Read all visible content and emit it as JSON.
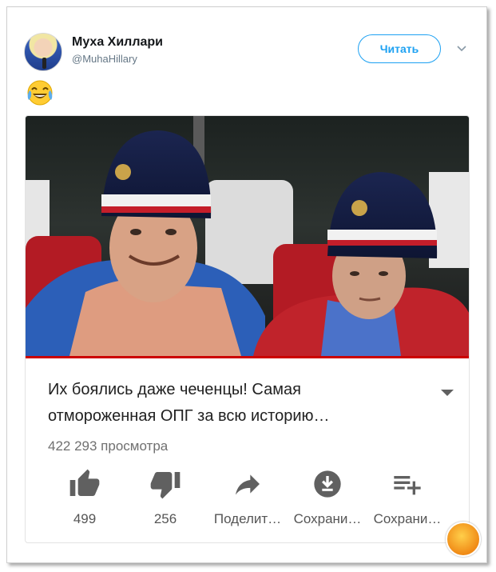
{
  "tweet": {
    "user_name": "Муха Хиллари",
    "user_handle": "@MuhaHillary",
    "follow_label": "Читать",
    "emoji": "😂"
  },
  "video": {
    "title_line1": "Их боялись даже чеченцы! Самая",
    "title_line2": "отмороженная ОПГ за всю историю…",
    "views": "422 293 просмотра",
    "actions": [
      {
        "icon": "thumbs-up-icon",
        "label": "499"
      },
      {
        "icon": "thumbs-down-icon",
        "label": "256"
      },
      {
        "icon": "share-icon",
        "label": "Поделит…"
      },
      {
        "icon": "download-icon",
        "label": "Сохрани…"
      },
      {
        "icon": "add-to-playlist-icon",
        "label": "Сохрани…"
      }
    ]
  },
  "colors": {
    "accent": "#1da1f2",
    "progress": "#cc0000",
    "icon": "#606060"
  }
}
